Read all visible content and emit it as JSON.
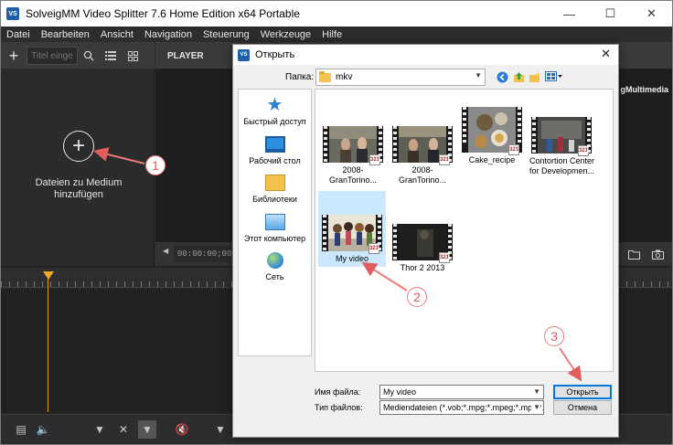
{
  "app": {
    "title": "SolveigMM Video Splitter 7.6 Home Edition x64 Portable",
    "icon_text": "VS",
    "window_buttons": [
      "—",
      "☐",
      "✕"
    ]
  },
  "menu": [
    "Datei",
    "Bearbeiten",
    "Ansicht",
    "Navigation",
    "Steuerung",
    "Werkzeuge",
    "Hilfe"
  ],
  "left_panel": {
    "search_placeholder": "Titel einge",
    "add_media_label": "Dateien zu Medium hinzufügen"
  },
  "player": {
    "label": "PLAYER",
    "brand": "gMultimedia",
    "time": "00:00:00;00"
  },
  "dialog": {
    "title": "Открыть",
    "look_in_label": "Папка:",
    "look_in_value": "mkv",
    "places": [
      {
        "label": "Быстрый доступ",
        "icon": "star-icon"
      },
      {
        "label": "Рабочий стол",
        "icon": "desktop-icon"
      },
      {
        "label": "Библиотеки",
        "icon": "libraries-icon"
      },
      {
        "label": "Этот компьютер",
        "icon": "computer-icon"
      },
      {
        "label": "Сеть",
        "icon": "network-icon"
      }
    ],
    "files": [
      {
        "name": "2008-GranTorino...",
        "selected": false
      },
      {
        "name": "2008-GranTorino...",
        "selected": false
      },
      {
        "name": "Cake_recipe",
        "selected": false
      },
      {
        "name": "Contortion Center for Developmen...",
        "selected": false
      },
      {
        "name": "My video",
        "selected": true
      },
      {
        "name": "Thor 2 2013",
        "selected": false
      }
    ],
    "badge_text": "321",
    "filename_label": "Имя файла:",
    "filename_value": "My video",
    "filetype_label": "Тип файлов:",
    "filetype_value": "Mediendateien (*.vob;*.mpg;*.mpeg;*.mpv;*.m2v",
    "open_button": "Открыть",
    "cancel_button": "Отмена"
  },
  "annotations": [
    "1",
    "2",
    "3"
  ],
  "colors": {
    "dark_bg": "#2d2d30",
    "selection": "#cce8ff",
    "annotation": "#e25c5c",
    "playhead": "#f0a830"
  }
}
